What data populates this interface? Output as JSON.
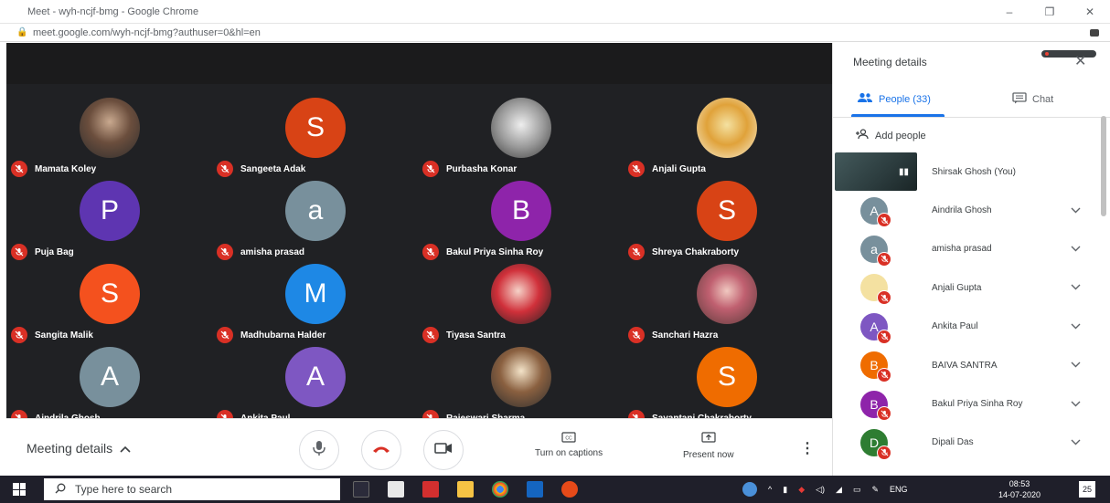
{
  "browser": {
    "title": "Meet - wyh-ncjf-bmg - Google Chrome",
    "url": "meet.google.com/wyh-ncjf-bmg?authuser=0&hl=en",
    "controls": [
      "–",
      "❐",
      "✕"
    ]
  },
  "colors": {
    "stage_bg": "#202124",
    "muted_red": "#d93025",
    "accent_blue": "#1a73e8"
  },
  "tiles": [
    {
      "name": "Mamata Koley",
      "initial": "",
      "color": "",
      "photo": "photo"
    },
    {
      "name": "Sangeeta Adak",
      "initial": "S",
      "color": "#d84315",
      "photo": ""
    },
    {
      "name": "Purbasha Konar",
      "initial": "",
      "color": "",
      "photo": "photo2"
    },
    {
      "name": "Anjali Gupta",
      "initial": "",
      "color": "",
      "photo": "photo3"
    },
    {
      "name": "Puja Bag",
      "initial": "P",
      "color": "#5e35b1",
      "photo": ""
    },
    {
      "name": "amisha prasad",
      "initial": "a",
      "color": "#78909c",
      "photo": ""
    },
    {
      "name": "Bakul Priya Sinha Roy",
      "initial": "B",
      "color": "#8e24aa",
      "photo": ""
    },
    {
      "name": "Shreya Chakraborty",
      "initial": "S",
      "color": "#d84315",
      "photo": ""
    },
    {
      "name": "Sangita Malik",
      "initial": "S",
      "color": "#f4511e",
      "photo": ""
    },
    {
      "name": "Madhubarna Halder",
      "initial": "M",
      "color": "#1e88e5",
      "photo": ""
    },
    {
      "name": "Tiyasa Santra",
      "initial": "",
      "color": "",
      "photo": "photo4"
    },
    {
      "name": "Sanchari Hazra",
      "initial": "",
      "color": "",
      "photo": "photo5"
    },
    {
      "name": "Aindrila Ghosh",
      "initial": "A",
      "color": "#78909c",
      "photo": ""
    },
    {
      "name": "Ankita Paul",
      "initial": "A",
      "color": "#7e57c2",
      "photo": ""
    },
    {
      "name": "Rajeswari Sharma",
      "initial": "",
      "color": "",
      "photo": "photo6"
    },
    {
      "name": "Sayantani Chakraborty",
      "initial": "S",
      "color": "#ef6c00",
      "photo": ""
    }
  ],
  "callbar": {
    "meeting_details": "Meeting details",
    "captions": "Turn on captions",
    "present": "Present now"
  },
  "panel": {
    "title": "Meeting details",
    "people_tab": "People (33)",
    "chat_tab": "Chat",
    "add_people": "Add people",
    "self_name": "Shirsak Ghosh (You)",
    "participants": [
      {
        "name": "Aindrila Ghosh",
        "initial": "A",
        "color": "#78909c"
      },
      {
        "name": "amisha prasad",
        "initial": "a",
        "color": "#78909c"
      },
      {
        "name": "Anjali Gupta",
        "initial": "",
        "color": "#f4e1a1"
      },
      {
        "name": "Ankita Paul",
        "initial": "A",
        "color": "#7e57c2"
      },
      {
        "name": "BAIVA SANTRA",
        "initial": "B",
        "color": "#ef6c00"
      },
      {
        "name": "Bakul Priya Sinha Roy",
        "initial": "B",
        "color": "#8e24aa"
      },
      {
        "name": "Dipali Das",
        "initial": "D",
        "color": "#2e7d32"
      }
    ]
  },
  "taskbar": {
    "search_placeholder": "Type here to search",
    "lang": "ENG",
    "time": "08:53",
    "date": "14-07-2020",
    "notif_count": "25"
  }
}
